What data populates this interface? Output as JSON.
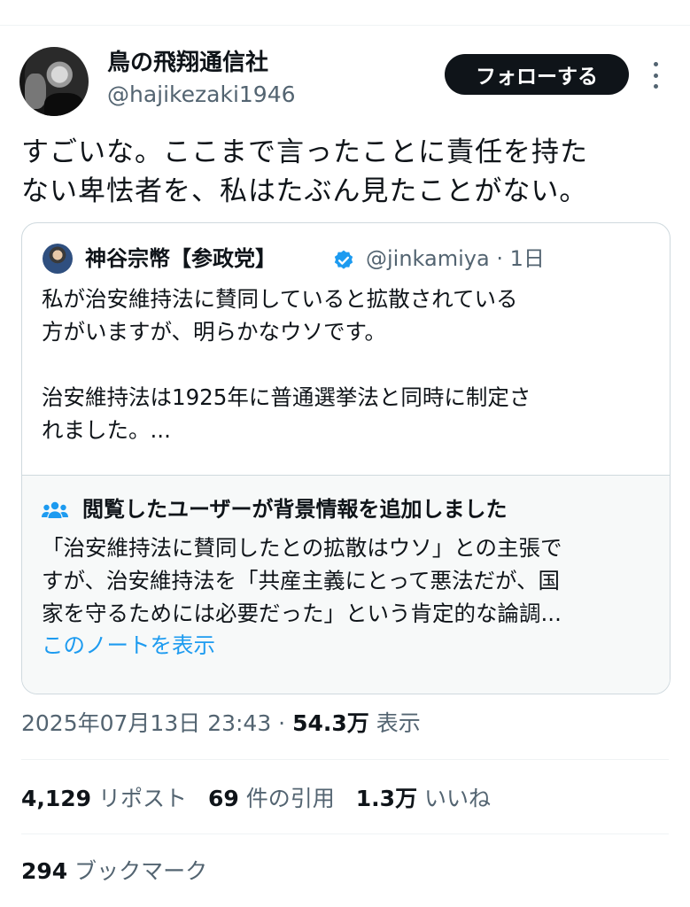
{
  "author": {
    "display_name": "鳥の飛翔通信社",
    "handle": "@hajikezaki1946"
  },
  "follow_label": "フォローする",
  "tweet_text": "すごいな。ここまで言ったことに責任を持た\nない卑怯者を、私はたぶん見たことがない。",
  "quote": {
    "display_name": "神谷宗幣【参政党】",
    "handle_time": "@jinkamiya · 1日",
    "text": "私が治安維持法に賛同していると拡散されている\n方がいますが、明らかなウソです。\n\n治安維持法は1925年に普通選挙法と同時に制定さ\nれました。...",
    "note": {
      "title": "閲覧したユーザーが背景情報を追加しました",
      "text": "「治安維持法に賛同したとの拡散はウソ」との主張で\nすが、治安維持法を「共産主義にとって悪法だが、国\n家を守るためには必要だった」という肯定的な論調...",
      "link_label": "このノートを表示"
    }
  },
  "meta": {
    "timestamp": "2025年07月13日 23:43 · ",
    "views_count": "54.3万",
    "views_label": " 表示"
  },
  "stats": {
    "reposts_count": "4,129",
    "reposts_label": " リポスト",
    "quotes_count": "69",
    "quotes_label": " 件の引用",
    "likes_count": "1.3万",
    "likes_label": " いいね",
    "bookmarks_count": "294",
    "bookmarks_label": " ブックマーク"
  },
  "colors": {
    "accent": "#1d9bf0",
    "text_secondary": "#536471",
    "button_bg": "#0f1419"
  },
  "icons": [
    "more-icon",
    "verified-icon",
    "community-notes-icon"
  ]
}
